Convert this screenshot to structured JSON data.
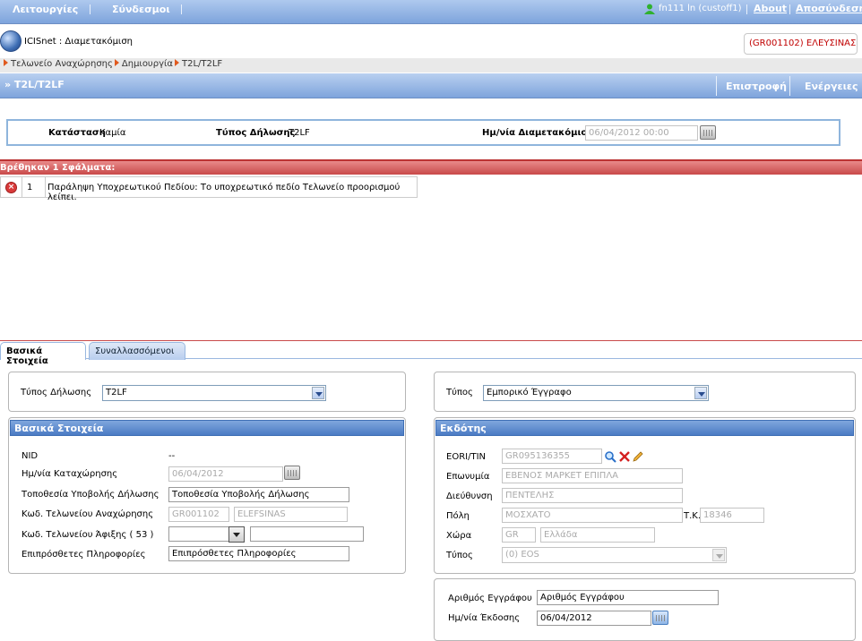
{
  "topbar": {
    "menu1": "Λειτουργίες",
    "menu2": "Σύνδεσμοι",
    "user": "fn111 ln (custoff1)",
    "about": "About",
    "logout": "Αποσύνδεση"
  },
  "app": {
    "title": "ICISnet : Διαμετακόμιση",
    "customs_office": "(GR001102) ΕΛΕΥΣΙΝΑΣ"
  },
  "breadcrumb": [
    "Τελωνείο Αναχώρησης",
    "Δημιουργία",
    "T2L/T2LF"
  ],
  "page": {
    "title": "» T2L/T2LF",
    "back": "Επιστροφή",
    "actions": "Ενέργειες"
  },
  "status": {
    "state_label": "Κατάσταση",
    "state_value": "Καμία",
    "type_label": "Τύπος Δήλωσης",
    "type_value": "T2LF",
    "date_label": "Ημ/νία Διαμετακόμισης",
    "date_value": "06/04/2012 00:00"
  },
  "errors": {
    "header": "Βρέθηκαν 1 Σφάλματα:",
    "items": [
      {
        "num": "1",
        "text": "Παράληψη Υποχρεωτικού Πεδίου: Το υποχρεωτικό πεδίο Τελωνείο προορισμού λείπει."
      }
    ]
  },
  "tabs": [
    "Βασικά Στοιχεία",
    "Συναλλασσόμενοι"
  ],
  "left": {
    "decl_type_label": "Τύπος Δήλωσης",
    "decl_type_value": "T2LF",
    "section_title": "Βασικά Στοιχεία",
    "nid_label": "NID",
    "nid_value": "--",
    "reg_date_label": "Ημ/νία Καταχώρησης",
    "reg_date_value": "06/04/2012",
    "location_label": "Τοποθεσία Υποβολής Δήλωσης",
    "location_value": "Τοποθεσία Υποβολής Δήλωσης",
    "dep_office_label": "Κωδ. Τελωνείου Αναχώρησης",
    "dep_office_code": "GR001102",
    "dep_office_name": "ELEFSINAS",
    "arr_office_label": "Κωδ. Τελωνείου Άφιξης ( 53 )",
    "extra_label": "Επιπρόσθετες Πληροφορίες",
    "extra_value": "Επιπρόσθετες Πληροφορίες"
  },
  "right": {
    "type_label": "Τύπος",
    "type_value": "Εμπορικό Έγγραφο",
    "section_title": "Εκδότης",
    "eori_label": "EORI/TIN",
    "eori_value": "GR095136355",
    "name_label": "Επωνυμία",
    "name_value": "ΕΒΕΝΟΣ ΜΑΡΚΕΤ ΕΠΙΠΛΑ",
    "address_label": "Διεύθυνση",
    "address_value": "ΠΕΝΤΕΛΗΣ",
    "city_label": "Πόλη",
    "city_value": "ΜΟΣΧΑΤΟ",
    "zip_label": "Τ.Κ.",
    "zip_value": "18346",
    "country_label": "Χώρα",
    "country_code": "GR",
    "country_name": "Ελλάδα",
    "kind_label": "Τύπος",
    "kind_value": "(0) EOS",
    "doc_no_label": "Αριθμός Εγγράφου",
    "doc_no_value": "Αριθμός Εγγράφου",
    "issue_date_label": "Ημ/νία Έκδοσης",
    "issue_date_value": "06/04/2012"
  },
  "colors": {
    "header_blue": "#7ea4dc",
    "error_red": "#c94a4a",
    "office_red": "#c00000"
  }
}
